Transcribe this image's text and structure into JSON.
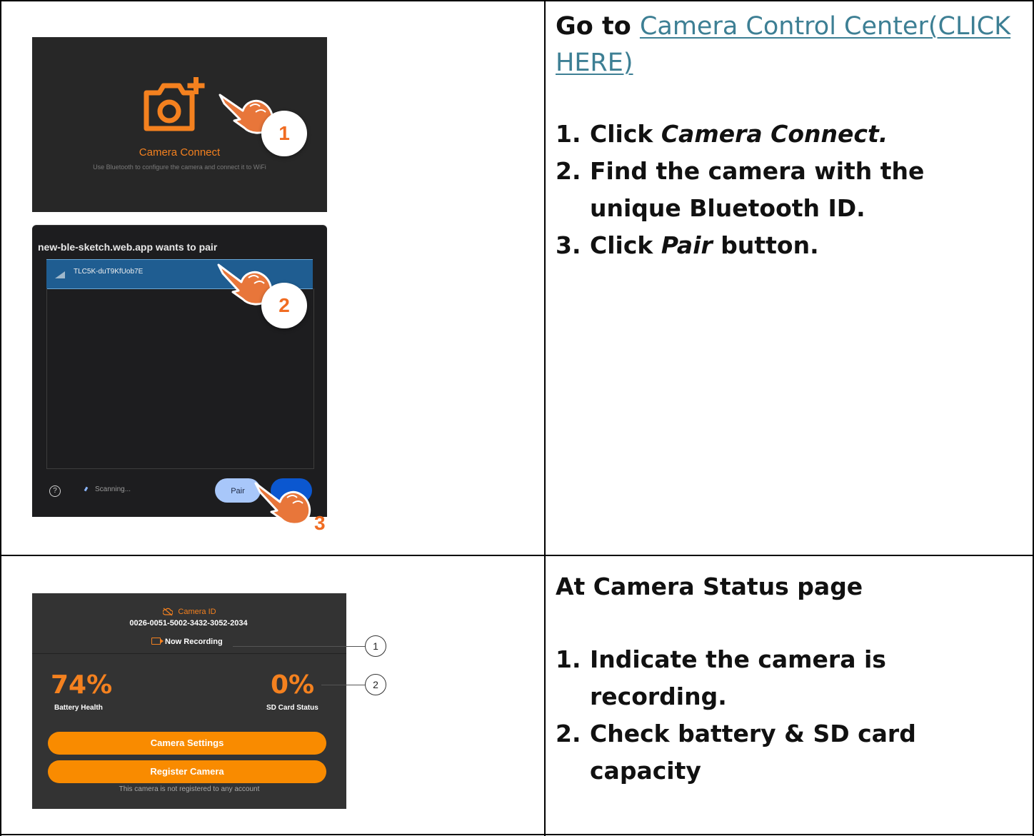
{
  "row1": {
    "goto_prefix": "Go to",
    "goto_link": "Camera Control Center(CLICK HERE)",
    "steps": [
      {
        "num": "1.",
        "pre": "Click ",
        "em": "Camera Connect.",
        "post": ""
      },
      {
        "num": "2.",
        "pre": "Find the camera with the unique Bluetooth ID.",
        "em": "",
        "post": ""
      },
      {
        "num": "3.",
        "pre": "Click ",
        "em": "Pair",
        "post": " button."
      }
    ]
  },
  "shot_connect": {
    "title": "Camera Connect",
    "subtitle": "Use Bluetooth to configure the camera and connect it to WiFi",
    "icon": "camera-plus-icon",
    "accent": "#f4811f"
  },
  "shot_pair": {
    "title": "new-ble-sketch.web.app wants to pair",
    "device": "TLC5K-duT9KfUob7E",
    "help": "?",
    "status": "Scanning...",
    "pair_label": "Pair"
  },
  "callouts": [
    "1",
    "2",
    "3"
  ],
  "row2": {
    "heading": "At Camera Status page",
    "steps": [
      {
        "num": "1.",
        "text": "Indicate the camera is recording."
      },
      {
        "num": "2.",
        "text": "Check battery & SD card capacity"
      }
    ]
  },
  "shot_status": {
    "camera_id_label": "Camera ID",
    "camera_id": "0026-0051-5002-3432-3052-2034",
    "recording": "Now Recording",
    "battery_value": "74%",
    "battery_label": "Battery Health",
    "sd_value": "0%",
    "sd_label": "SD Card Status",
    "settings_btn": "Camera Settings",
    "register_btn": "Register Camera",
    "not_registered": "This camera is not registered to any account",
    "markers": [
      "1",
      "2"
    ]
  }
}
